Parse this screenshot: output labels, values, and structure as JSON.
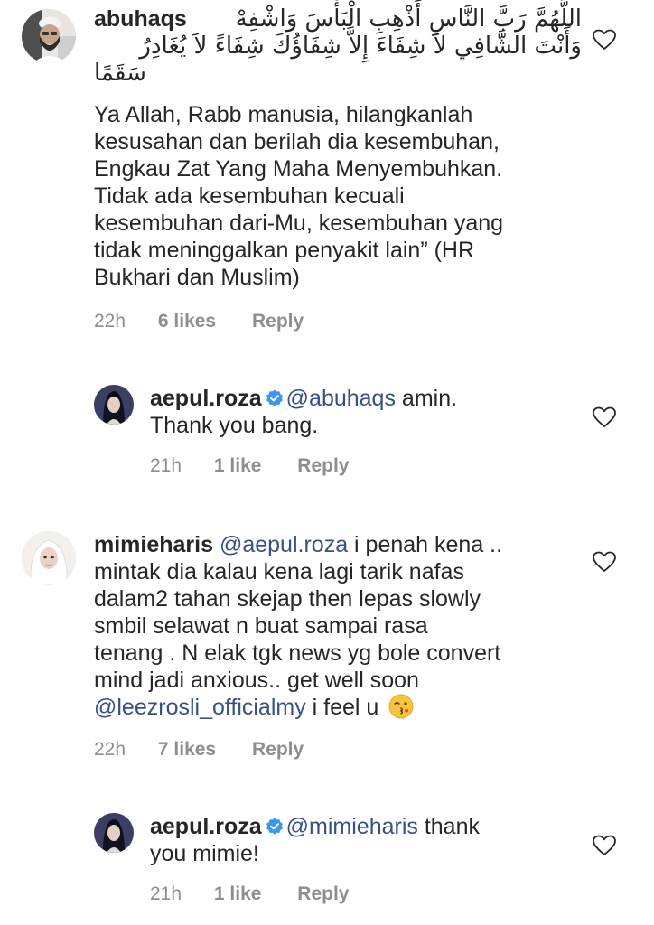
{
  "comments": [
    {
      "username": "abuhaqs",
      "arabic_line1": "اللَّهُمَّ رَبَّ النَّاسِ أَذْهِبِ الْبَأْسَ وَاشْفِهْ",
      "arabic_line2": "وَأَنْتَ الشَّافِي لاَ شِفَاءَ إِلاَّ شِفَاؤُكَ شِفَاءً لاَ يُغَادِرُ",
      "arabic_line3": "سَقَمًا",
      "text_lines": [
        "Ya Allah, Rabb manusia, hilangkanlah",
        "kesusahan dan berilah dia kesembuhan,",
        "Engkau Zat Yang Maha Menyembuhkan.",
        "Tidak ada kesembuhan kecuali",
        "kesembuhan dari-Mu, kesembuhan yang",
        "tidak meninggalkan penyakit lain” (HR",
        "Bukhari dan Muslim)"
      ],
      "time": "22h",
      "likes": "6 likes",
      "reply": "Reply"
    },
    {
      "username": "aepul.roza",
      "mention": "@abuhaqs",
      "text_line1_rest": " amin.",
      "text_line2": "Thank you bang.",
      "time": "21h",
      "likes": "1 like",
      "reply": "Reply"
    },
    {
      "username": "mimieharis",
      "mention": "@aepul.roza",
      "text_line1_rest": " i penah kena ..",
      "text_lines": [
        "mintak dia kalau kena lagi tarik nafas",
        "dalam2 tahan skejap then lepas slowly",
        "smbil selawat n buat sampai rasa",
        "tenang . N elak tgk news yg bole convert",
        "mind jadi anxious.. get well soon"
      ],
      "mention2": "@leezrosli_officialmy",
      "text_last_rest": " i feel u",
      "emoji": "face-blowing-a-kiss",
      "time": "22h",
      "likes": "7 likes",
      "reply": "Reply"
    },
    {
      "username": "aepul.roza",
      "mention": "@mimieharis",
      "text_line1_rest": " thank",
      "text_line2": "you mimie!",
      "time": "21h",
      "likes": "1 like",
      "reply": "Reply"
    }
  ],
  "icons": {
    "like": "heart-outline-icon",
    "verified": "verified-badge-icon"
  },
  "colors": {
    "text": "#262626",
    "mention": "#385185",
    "meta": "#8e8e8e",
    "verified": "#3897f0"
  }
}
